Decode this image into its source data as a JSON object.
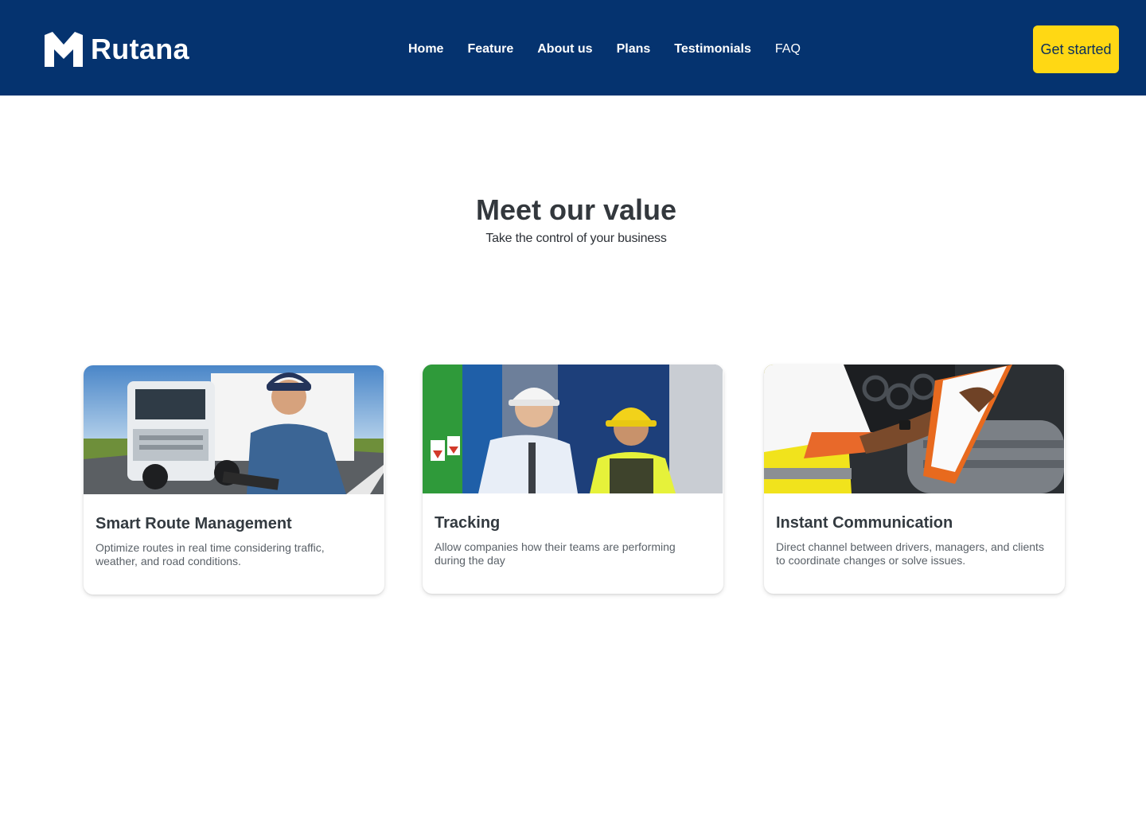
{
  "brand": {
    "name": "Rutana",
    "logo_icon": "chevron-up-logo-icon"
  },
  "nav": {
    "links": [
      "Home",
      "Feature",
      "About us",
      "Plans",
      "Testimonials",
      "FAQ"
    ],
    "cta_label": "Get started"
  },
  "colors": {
    "navbar": "#05336f",
    "accent": "#ffd814",
    "heading": "#33383d"
  },
  "hero": {
    "title": "Meet our value",
    "subtitle": "Take the control of your business"
  },
  "cards": [
    {
      "title": "Smart Route Management",
      "description": "Optimize routes in real time considering traffic, weather, and road conditions.",
      "image": "truck-driver-photo"
    },
    {
      "title": "Tracking",
      "description": "Allow companies how their teams are performing during the day",
      "image": "warehouse-workers-photo"
    },
    {
      "title": "Instant Communication",
      "description": "Direct channel between drivers, managers, and clients to coordinate changes or solve issues.",
      "image": "clipboard-checklist-photo"
    }
  ]
}
